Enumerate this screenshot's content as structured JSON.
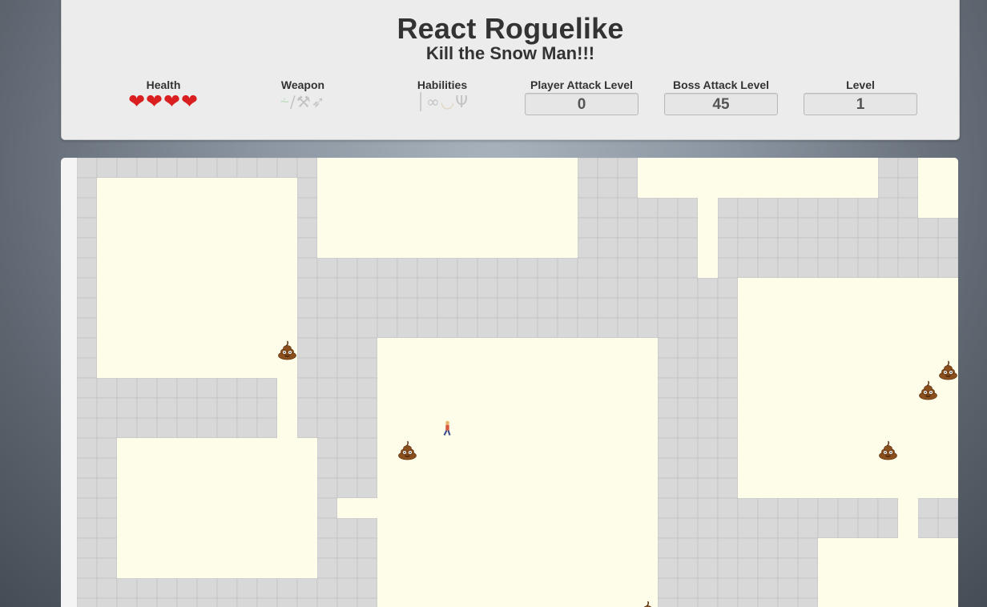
{
  "header": {
    "title": "React Roguelike",
    "subtitle": "Kill the Snow Man!!!"
  },
  "stats": {
    "health_label": "Health",
    "health_hearts": 4,
    "weapon_label": "Weapon",
    "weapon_icons": [
      "water-pistol-icon",
      "knife-icon",
      "hammer-icon",
      "bow-icon"
    ],
    "habilities_label": "Habilities",
    "hability_icons": [
      "boot-icon",
      "glasses-icon",
      "bread-icon",
      "fork-icon"
    ],
    "player_attack_label": "Player Attack Level",
    "player_attack_value": "0",
    "boss_attack_label": "Boss Attack Level",
    "boss_attack_value": "45",
    "level_label": "Level",
    "level_value": "1"
  },
  "colors": {
    "floor": "#fefde9",
    "wall": "#d8d8d8",
    "wall_grid": "#bdbdbd",
    "heart": "#d91f1f"
  },
  "board": {
    "cell_size": 25,
    "cols": 44,
    "rows": 23,
    "floor_rooms": [
      [
        1,
        1,
        10,
        10
      ],
      [
        12,
        0,
        13,
        5
      ],
      [
        28,
        0,
        12,
        2
      ],
      [
        42,
        0,
        2,
        3
      ],
      [
        10,
        11,
        1,
        3
      ],
      [
        2,
        14,
        10,
        7
      ],
      [
        15,
        9,
        14,
        14
      ],
      [
        33,
        6,
        11,
        11
      ],
      [
        31,
        2,
        1,
        4
      ],
      [
        13,
        17,
        2,
        1
      ],
      [
        41,
        17,
        1,
        2
      ],
      [
        37,
        19,
        7,
        4
      ]
    ],
    "player": {
      "col": 18,
      "row": 13,
      "icon": "player-icon"
    },
    "enemies": [
      {
        "col": 10,
        "row": 9,
        "icon": "poop-enemy-icon"
      },
      {
        "col": 16,
        "row": 14,
        "icon": "poop-enemy-icon"
      },
      {
        "col": 43,
        "row": 10,
        "icon": "poop-enemy-icon"
      },
      {
        "col": 42,
        "row": 11,
        "icon": "poop-enemy-icon"
      },
      {
        "col": 40,
        "row": 14,
        "icon": "poop-enemy-icon"
      },
      {
        "col": 28,
        "row": 22,
        "icon": "poop-enemy-icon"
      }
    ]
  }
}
